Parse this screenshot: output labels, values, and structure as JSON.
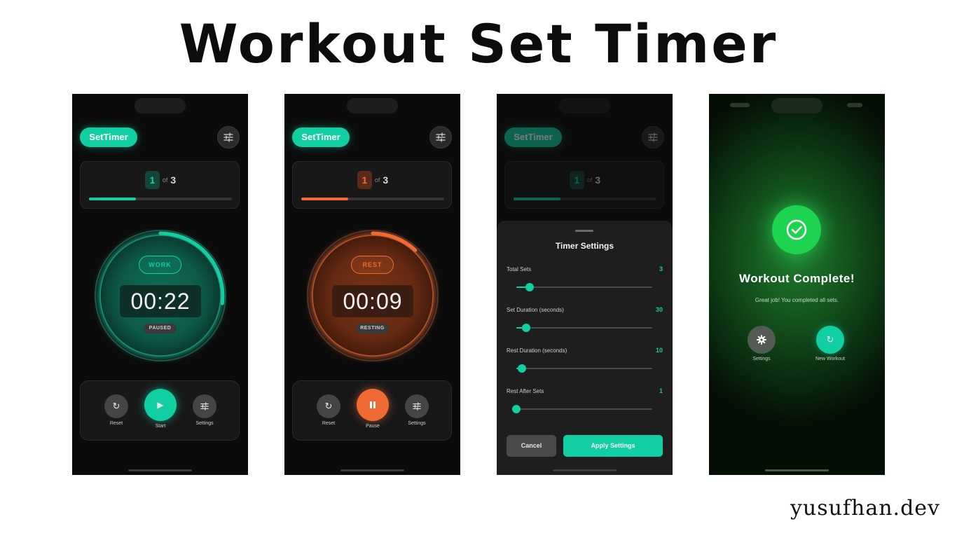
{
  "headline": "Workout Set Timer",
  "credit": "yusufhan.dev",
  "colors": {
    "accent": "#11cfa3",
    "rest": "#f06a35",
    "success": "#1ed34f"
  },
  "screens": [
    {
      "brand": "SetTimer",
      "settings_icon": "sliders-icon",
      "current_set": "1",
      "of_label": "of",
      "total_sets": "3",
      "set_progress": 0.33,
      "phase": "WORK",
      "time": "00:22",
      "state": "PAUSED",
      "ring_remaining": 0.27,
      "controls": {
        "reset": "Reset",
        "primary": "Start",
        "settings": "Settings"
      },
      "icons": {
        "reset": "refresh-icon",
        "primary": "play-icon",
        "settings": "sliders-icon"
      }
    },
    {
      "brand": "SetTimer",
      "settings_icon": "sliders-icon",
      "current_set": "1",
      "of_label": "of",
      "total_sets": "3",
      "set_progress": 0.33,
      "phase": "REST",
      "time": "00:09",
      "state": "RESTING",
      "ring_remaining": 0.12,
      "controls": {
        "reset": "Reset",
        "primary": "Pause",
        "settings": "Settings"
      },
      "icons": {
        "reset": "refresh-icon",
        "primary": "pause-icon",
        "settings": "sliders-icon"
      }
    },
    {
      "brand": "SetTimer",
      "current_set": "1",
      "of_label": "of",
      "total_sets": "3",
      "set_progress": 0.33,
      "sheet": {
        "title": "Timer Settings",
        "settings": [
          {
            "label": "Total Sets",
            "value": "3",
            "slider": 0.1
          },
          {
            "label": "Set Duration (seconds)",
            "value": "30",
            "slider": 0.07
          },
          {
            "label": "Rest Duration (seconds)",
            "value": "10",
            "slider": 0.04
          },
          {
            "label": "Rest After Sets",
            "value": "1",
            "slider": 0.0
          }
        ],
        "cancel": "Cancel",
        "apply": "Apply Settings"
      }
    },
    {
      "title": "Workout Complete!",
      "subtitle": "Great job! You completed all sets.",
      "check_icon": "check-circle-icon",
      "actions": {
        "settings": "Settings",
        "new_workout": "New Workout"
      },
      "icons": {
        "settings": "gear-icon",
        "new_workout": "refresh-icon"
      }
    }
  ]
}
